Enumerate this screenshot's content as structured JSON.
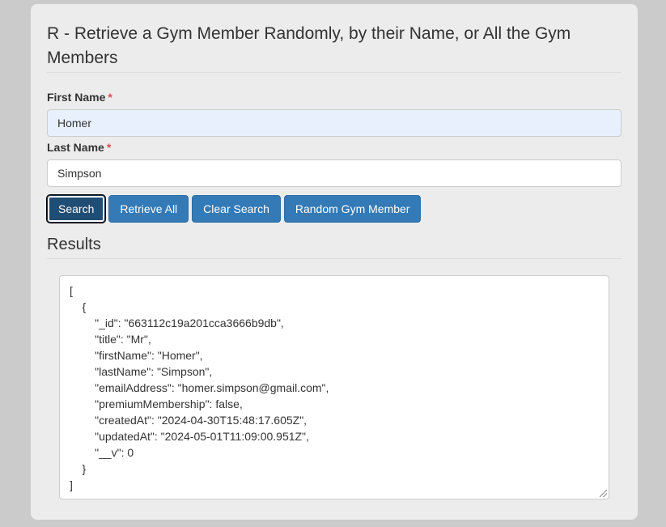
{
  "form": {
    "title": "R - Retrieve a Gym Member Randomly, by their Name, or All the Gym Members",
    "first_name_label": "First Name",
    "first_name_value": "Homer",
    "last_name_label": "Last Name",
    "last_name_value": "Simpson",
    "required_marker": "*"
  },
  "buttons": {
    "search": "Search",
    "retrieve_all": "Retrieve All",
    "clear_search": "Clear Search",
    "random": "Random Gym Member"
  },
  "results": {
    "heading": "Results",
    "text": "[\n    {\n        \"_id\": \"663112c19a201cca3666b9db\",\n        \"title\": \"Mr\",\n        \"firstName\": \"Homer\",\n        \"lastName\": \"Simpson\",\n        \"emailAddress\": \"homer.simpson@gmail.com\",\n        \"premiumMembership\": false,\n        \"createdAt\": \"2024-04-30T15:48:17.605Z\",\n        \"updatedAt\": \"2024-05-01T11:09:00.951Z\",\n        \"__v\": 0\n    }\n]"
  },
  "colors": {
    "page_bg": "#cbcbcb",
    "panel_bg": "#ececec",
    "button_primary": "#337ab7",
    "button_active": "#204d74",
    "required": "#d9534f",
    "autofill_bg": "#e8f0fe"
  }
}
